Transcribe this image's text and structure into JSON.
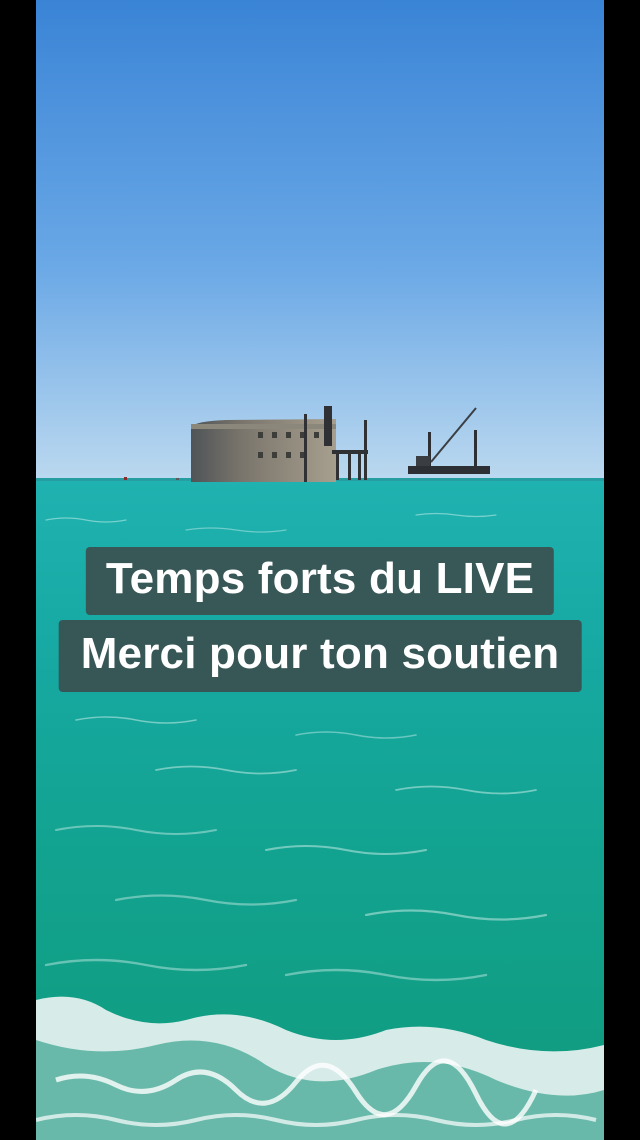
{
  "caption": {
    "line1": "Temps forts du LIVE",
    "line2": "Merci pour ton soutien"
  },
  "colors": {
    "sky_top": "#3d86d6",
    "sky_horizon": "#b9d7f0",
    "sea_far": "#1aa8a6",
    "sea_near": "#0e9d80",
    "foam": "#e9f4f2",
    "fort": "#6f6b63",
    "caption_bg": "#404040",
    "caption_text": "#ffffff"
  }
}
